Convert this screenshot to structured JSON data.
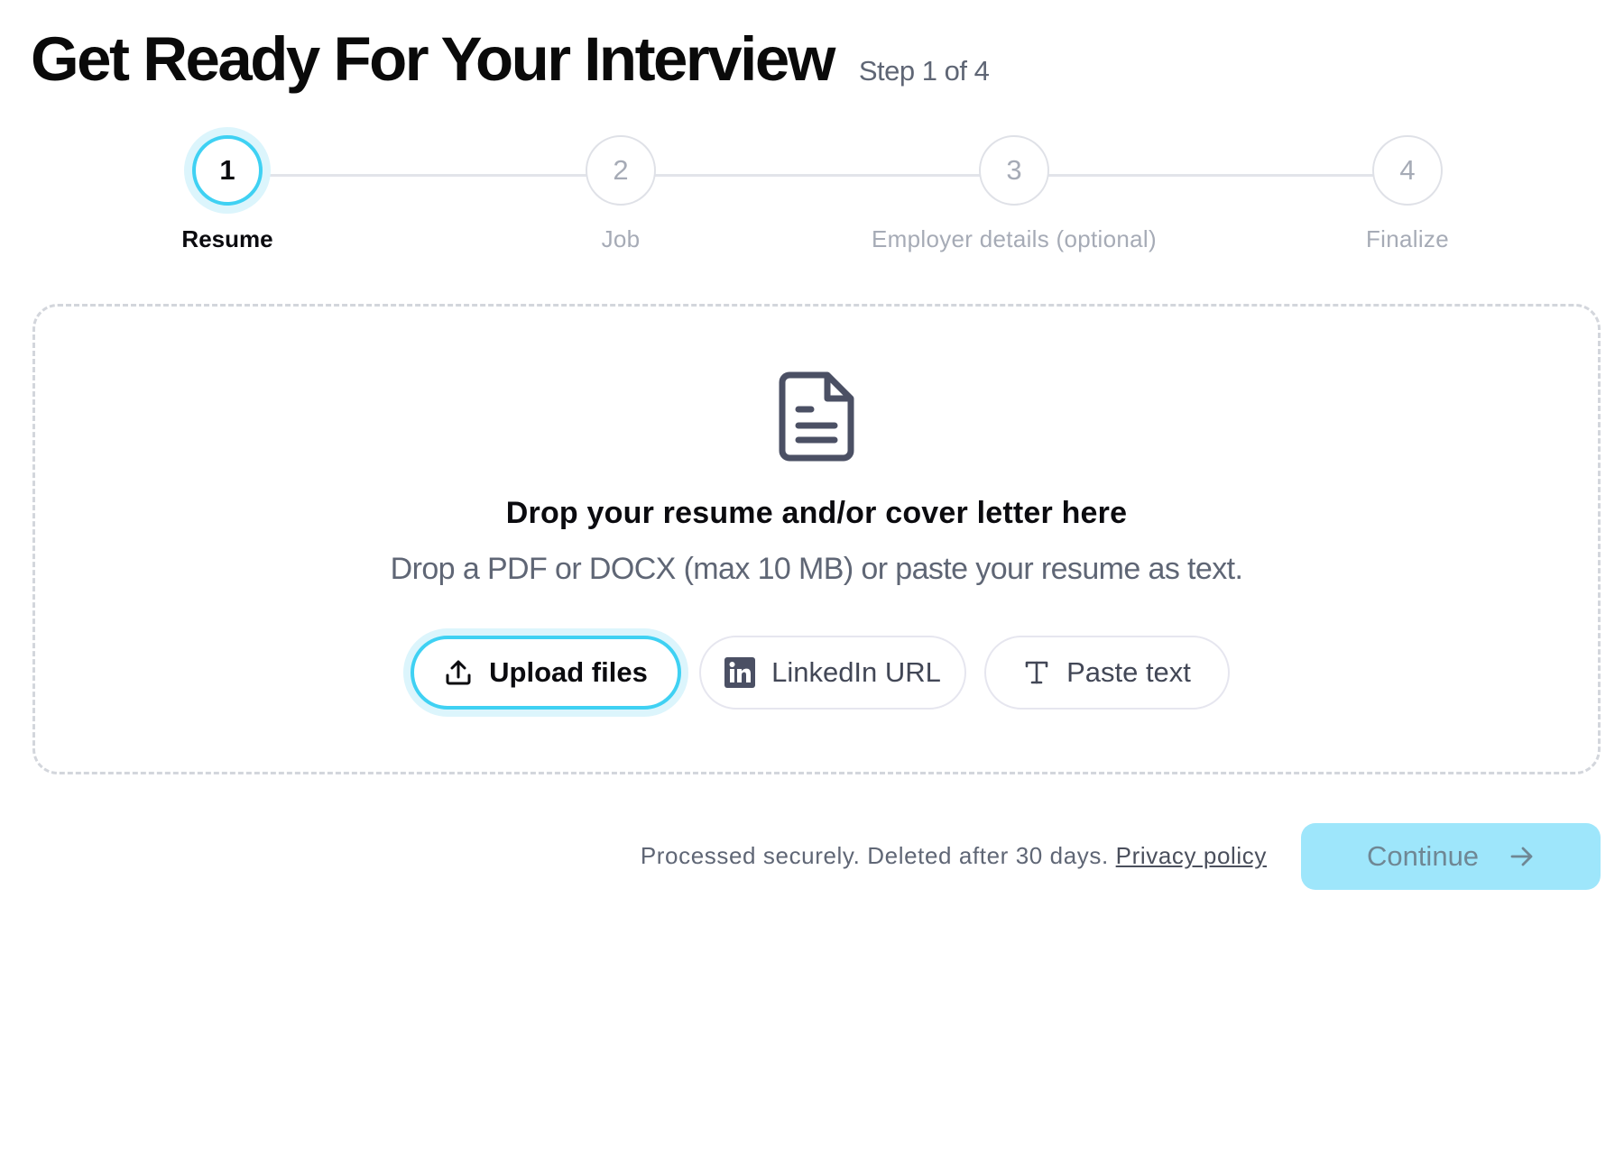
{
  "header": {
    "title": "Get Ready For Your Interview",
    "step_indicator": "Step 1 of 4"
  },
  "stepper": {
    "steps": [
      {
        "number": "1",
        "label": "Resume",
        "state": "active"
      },
      {
        "number": "2",
        "label": "Job",
        "state": "inactive"
      },
      {
        "number": "3",
        "label": "Employer details (optional)",
        "state": "inactive"
      },
      {
        "number": "4",
        "label": "Finalize",
        "state": "inactive"
      }
    ]
  },
  "dropzone": {
    "icon": "document-icon",
    "title": "Drop your resume and/or cover letter here",
    "subtitle": "Drop a PDF or DOCX (max 10 MB) or paste your resume as text.",
    "options": {
      "upload": {
        "label": "Upload files",
        "icon": "upload-icon"
      },
      "linkedin": {
        "label": "LinkedIn URL",
        "icon": "linkedin-icon"
      },
      "paste": {
        "label": "Paste text",
        "icon": "text-icon"
      }
    }
  },
  "footer": {
    "note": "Processed securely. Deleted after 30 days.",
    "privacy_link": "Privacy policy",
    "continue_label": "Continue",
    "continue_icon": "arrow-right-icon"
  },
  "colors": {
    "accent": "#3fd1f3",
    "accent_halo": "#dcf5fc",
    "continue_disabled_bg": "#9ee6fb",
    "muted_text": "#5f6675",
    "inactive_step": "#a6abb6"
  }
}
